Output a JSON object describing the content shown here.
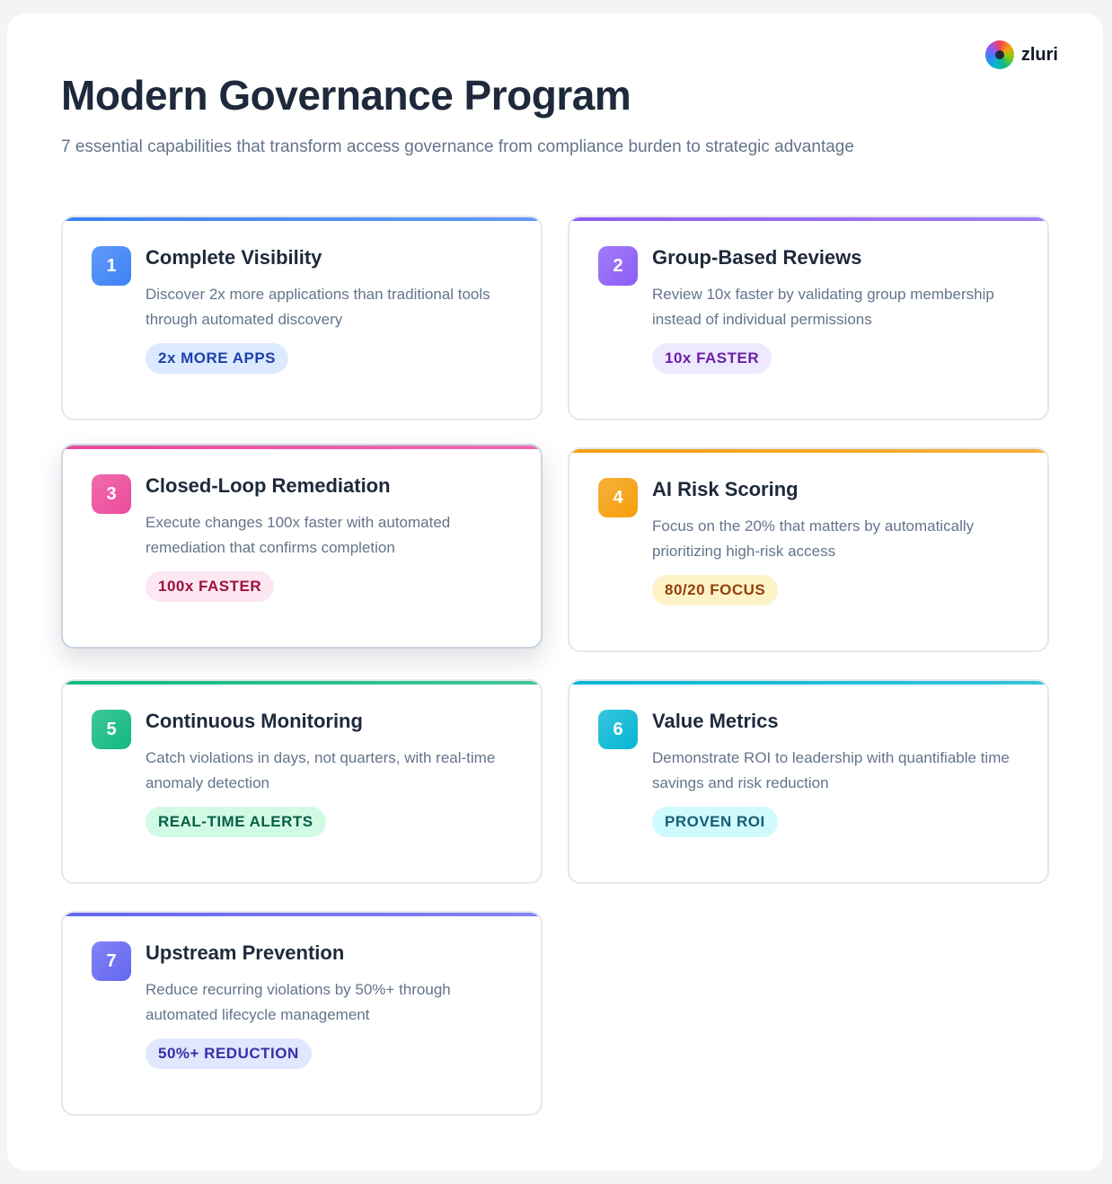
{
  "header": {
    "title": "Modern Governance Program",
    "subtitle": "7 essential capabilities that transform access governance from compliance burden to strategic advantage",
    "logo_text": "zluri"
  },
  "cards": [
    {
      "number": "1",
      "title": "Complete Visibility",
      "description": "Discover 2x more applications than traditional tools through automated discovery",
      "badge": "2x MORE APPS",
      "accent": "#3b82f6",
      "badge_bg": "#dbeafe",
      "badge_color": "#1e40af"
    },
    {
      "number": "2",
      "title": "Group-Based Reviews",
      "description": "Review 10x faster by validating group membership instead of individual permissions",
      "badge": "10x FASTER",
      "accent": "#8b5cf6",
      "badge_bg": "#ede9fe",
      "badge_color": "#6b21a8"
    },
    {
      "number": "3",
      "title": "Closed-Loop Remediation",
      "description": "Execute changes 100x faster with automated remediation that confirms completion",
      "badge": "100x FASTER",
      "accent": "#ec4899",
      "badge_bg": "#fce7f3",
      "badge_color": "#9f1239"
    },
    {
      "number": "4",
      "title": "AI Risk Scoring",
      "description": "Focus on the 20% that matters by automatically prioritizing high-risk access",
      "badge": "80/20 FOCUS",
      "accent": "#f59e0b",
      "badge_bg": "#fef3c7",
      "badge_color": "#92400e"
    },
    {
      "number": "5",
      "title": "Continuous Monitoring",
      "description": "Catch violations in days, not quarters, with real-time anomaly detection",
      "badge": "REAL-TIME ALERTS",
      "accent": "#10b981",
      "badge_bg": "#d1fae5",
      "badge_color": "#065f46"
    },
    {
      "number": "6",
      "title": "Value Metrics",
      "description": "Demonstrate ROI to leadership with quantifiable time savings and risk reduction",
      "badge": "PROVEN ROI",
      "accent": "#06b6d4",
      "badge_bg": "#cffafe",
      "badge_color": "#155e75"
    },
    {
      "number": "7",
      "title": "Upstream Prevention",
      "description": "Reduce recurring violations by 50%+ through automated lifecycle management",
      "badge": "50%+ REDUCTION",
      "accent": "#6366f1",
      "badge_bg": "#e0e7ff",
      "badge_color": "#3730a3"
    }
  ]
}
